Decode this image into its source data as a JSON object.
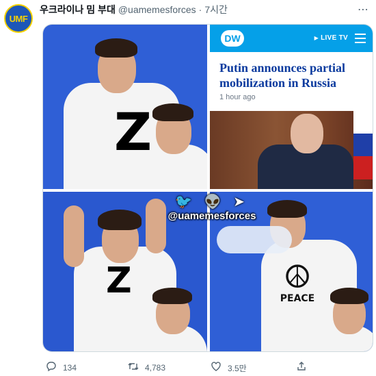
{
  "tweet": {
    "avatar_text": "UMF",
    "display_name": "우크라이나 밈 부대",
    "handle": "@uamemesforces",
    "separator": "·",
    "time": "7시간",
    "more_icon": "⋯"
  },
  "meme": {
    "panel1": {
      "mark": "Z"
    },
    "panel2": {
      "logo": "DW",
      "live_tv": "LIVE TV",
      "headline": "Putin announces partial mobilization in Russia",
      "age": "1 hour ago"
    },
    "panel3": {
      "mark": "Z"
    },
    "panel4": {
      "peace_symbol": "☮",
      "label": "PEACE"
    },
    "watermark": {
      "icons": "🐦 👽 ➤",
      "handle": "@uamemesforces"
    }
  },
  "actions": {
    "reply": {
      "icon": "speech-bubble-icon",
      "count": "134"
    },
    "retweet": {
      "icon": "retweet-icon",
      "count": "4,783"
    },
    "like": {
      "icon": "heart-icon",
      "count": "3.5만"
    },
    "share": {
      "icon": "share-icon"
    }
  },
  "colors": {
    "dw_blue": "#05a0e8",
    "headline_blue": "#0a3a9e",
    "meme_blue_background": "#2f5fd6",
    "avatar_blue": "#1d57b8",
    "avatar_yellow": "#f6d100"
  }
}
